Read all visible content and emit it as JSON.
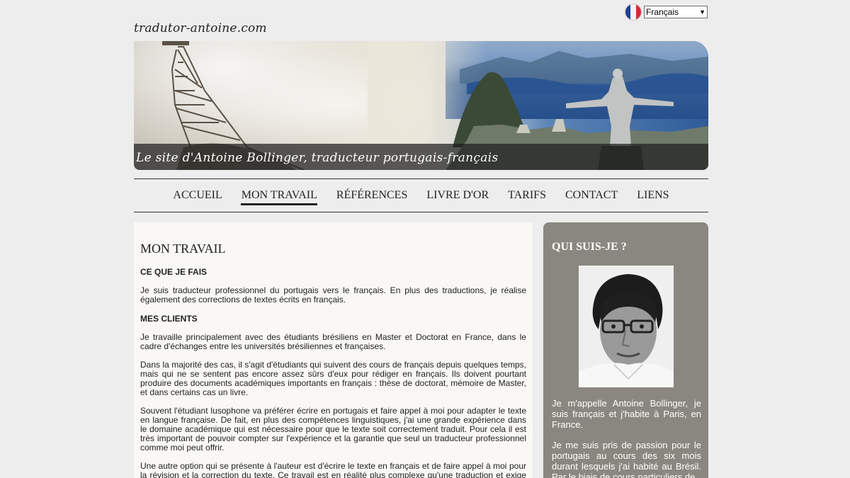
{
  "language_selector": {
    "flag_icon": "france-flag-icon",
    "selected": "Français"
  },
  "site_name": "tradutor-antoine.com",
  "banner": {
    "caption": "Le site d'Antoine Bollinger, traducteur portugais-français"
  },
  "nav": {
    "items": [
      {
        "label": "ACCUEIL"
      },
      {
        "label": "MON TRAVAIL"
      },
      {
        "label": "RÉFÉRENCES"
      },
      {
        "label": "LIVRE D'OR"
      },
      {
        "label": "TARIFS"
      },
      {
        "label": "CONTACT"
      },
      {
        "label": "LIENS"
      }
    ],
    "active": "MON TRAVAIL"
  },
  "main": {
    "title": "MON TRAVAIL",
    "sections": [
      {
        "heading": "CE QUE JE FAIS",
        "paragraphs": [
          "Je suis traducteur professionnel du portugais vers le français. En plus des traductions, je réalise également des corrections de textes écrits en français."
        ]
      },
      {
        "heading": "MES CLIENTS",
        "paragraphs": [
          "Je travaille principalement avec des étudiants brésiliens en Master et Doctorat en France, dans le cadre d'échanges entre les universités brésiliennes et françaises.",
          "Dans la majorité des cas, il s'agit d'étudiants qui suivent des cours de français depuis quelques temps, mais qui ne se sentent pas encore assez sûrs d'eux pour rédiger en français. Ils doivent pourtant produire des documents académiques importants en français : thèse de doctorat, mémoire de Master, et dans certains cas un livre.",
          "Souvent l'étudiant lusophone va préférer écrire en portugais et faire appel à moi pour adapter le texte en langue française. De fait, en plus des compétences linguistiques, j'ai une grande expérience dans le domaine académique qui est nécessaire pour que le texte soit correctement traduit. Pour cela il est très important de pouvoir compter sur l'expérience et la garantie que seul un traducteur professionnel comme moi peut offrir.",
          "Une autre option qui se présente à l'auteur est d'écrire le texte en français et de faire appel à moi pour la révision et la correction du texte. Ce travail est en réalité plus complexe qu'une traduction et exige une"
        ]
      }
    ]
  },
  "sidebar": {
    "title": "QUI SUIS-JE ?",
    "paragraphs": [
      "Je m'appelle Antoine Bollinger, je suis français et j'habite à Paris, en France.",
      "Je me suis pris de passion pour le portugais au cours des six mois durant lesquels j'ai habité au Brésil. Par le biais de cours particuliers de"
    ]
  }
}
